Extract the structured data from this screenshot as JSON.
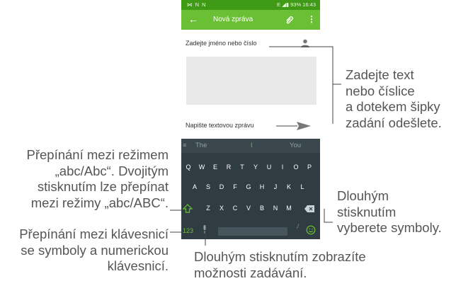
{
  "status_bar": {
    "left_icons": "⋈ N N",
    "right_text": "E ◢▮ 93% 16:43"
  },
  "app_bar": {
    "title": "Nová zpráva",
    "back_icon": "←",
    "more_icon": "⋮"
  },
  "recipient_placeholder": "Zadejte jméno nebo číslo",
  "message_placeholder": "Napište textovou zprávu",
  "keyboard": {
    "menu_icon": "≡",
    "suggestions": [
      "The",
      "I",
      "You"
    ],
    "rows": [
      [
        "Q",
        "W",
        "E",
        "R",
        "T",
        "Y",
        "U",
        "I",
        "O",
        "P"
      ],
      [
        "A",
        "S",
        "D",
        "F",
        "G",
        "H",
        "J",
        "K",
        "L"
      ],
      [
        "Z",
        "X",
        "C",
        "V",
        "B",
        "N",
        "M"
      ]
    ],
    "numeric_label": "123",
    "slash_label": ",/"
  },
  "annotations": {
    "send": "Zadejte text\nnebo číslice\na dotekem šipky\nzadání odešlete.",
    "shift": "Přepínání mezi režimem\n„abc/Abc“. Dvojitým\nstisknutím lze přepínat\nmezi režimy „abc/ABC“.",
    "numeric": "Přepínání mezi klávesnicí\nse symboly a numerickou\nklávesnicí.",
    "symbols": "Dlouhým\nstisknutím\nvyberete symboly.",
    "input_options": "Dlouhým stisknutím zobrazíte\nmožnosti zadávání."
  },
  "colors": {
    "accent": "#6bbf34",
    "status_bar": "#3f9b15",
    "keyboard": "#2f3d43"
  }
}
